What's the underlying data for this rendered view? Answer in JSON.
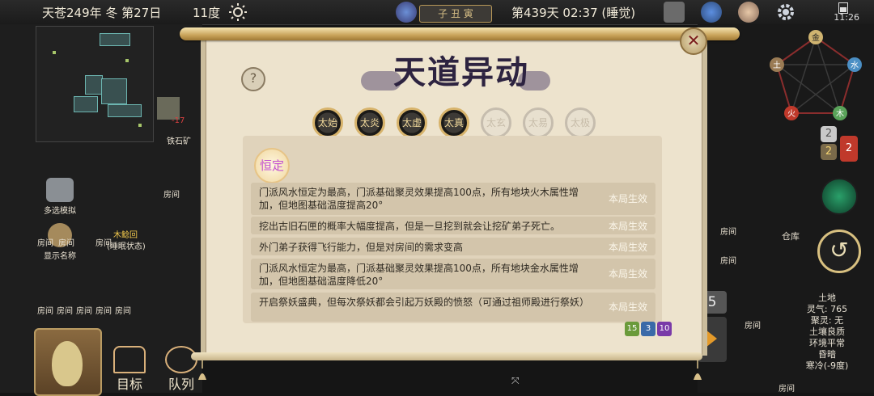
{
  "topbar": {
    "date": "天苍249年 冬 第27日",
    "temperature": "11度",
    "zodiac": "子 丑 寅",
    "day_time": "第439天 02:37 (睡觉)",
    "clock": "11:26"
  },
  "left": {
    "labels": {
      "room": "房间",
      "ore": "铁石矿",
      "minus": "-17",
      "multi_select": "多选模拟",
      "show_name": "显示名称",
      "bed_name": "木鲶回",
      "bed_status": "(睡眠状态)"
    },
    "nav": {
      "target": "目标",
      "queue": "队列"
    }
  },
  "dialog": {
    "title": "天道异动",
    "help_glyph": "?",
    "close_glyph": "✕",
    "tabs": [
      {
        "label": "太始",
        "active": true
      },
      {
        "label": "太炎",
        "active": true
      },
      {
        "label": "太虚",
        "active": true
      },
      {
        "label": "太真",
        "active": true
      },
      {
        "label": "太玄",
        "active": false
      },
      {
        "label": "太易",
        "active": false
      },
      {
        "label": "太极",
        "active": false
      }
    ],
    "section_badge": "恒定",
    "effects": [
      {
        "text": "门派风水恒定为最高，门派基础聚灵效果提高100点，所有地块火木属性增加，但地图基础温度提高20°",
        "tag": "本局生效"
      },
      {
        "text": "挖出古旧石匣的概率大幅度提高，但是一旦挖到就会让挖矿弟子死亡。",
        "tag": "本局生效"
      },
      {
        "text": "外门弟子获得飞行能力，但是对房间的需求变高",
        "tag": "本局生效"
      },
      {
        "text": "门派风水恒定为最高，门派基础聚灵效果提高100点，所有地块金水属性增加，但地图基础温度降低20°",
        "tag": "本局生效"
      },
      {
        "text": "开启祭妖盛典，但每次祭妖都会引起万妖殿的愤怒（可通过祖师殿进行祭妖）",
        "tag": "本局生效"
      }
    ],
    "counters": [
      "15",
      "3",
      "10"
    ]
  },
  "right": {
    "elements": {
      "metal": "金",
      "water": "水",
      "wood": "木",
      "fire": "火",
      "earth": "土"
    },
    "badges": [
      "2",
      "2",
      "2"
    ],
    "side_tab_num": "5",
    "labels": {
      "room": "房间",
      "warehouse": "仓库"
    },
    "info": {
      "title": "土地",
      "lines": [
        "灵气: 765",
        "聚灵: 无",
        "土壤良质",
        "环境平常",
        "昏暗",
        "寒冷(-9度)"
      ]
    }
  },
  "colors": {
    "parchment": "#ede3cd",
    "row": "#d3c5ab",
    "accent_gold": "#d7b36b",
    "badge_purple": "#c24fd1"
  }
}
